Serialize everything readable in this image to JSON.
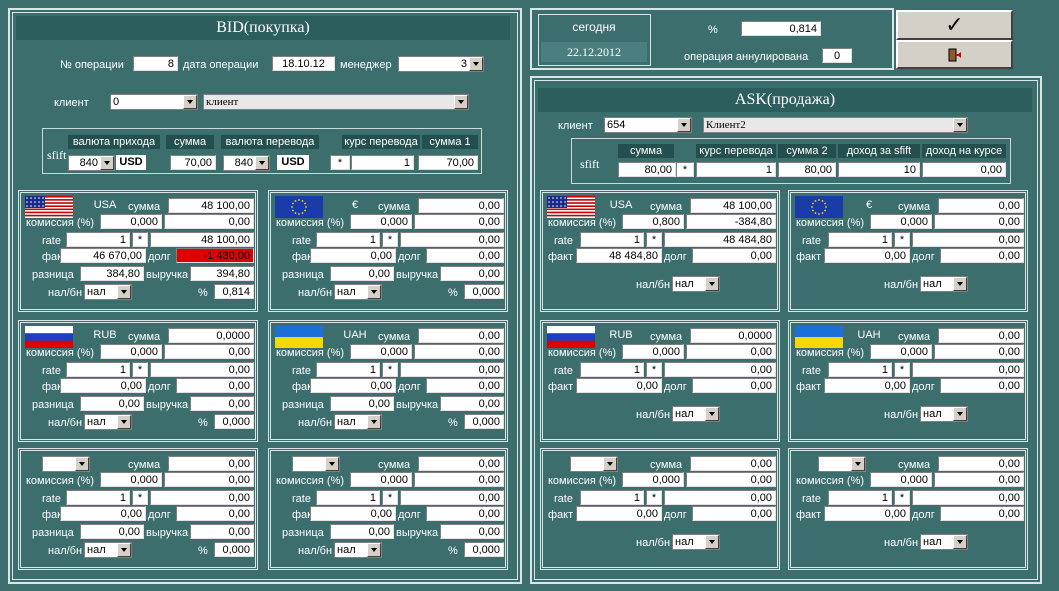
{
  "bid": {
    "title": "BID(покупка)",
    "op_no_label": "№ операции",
    "op_no": "8",
    "op_date_label": "дата операции",
    "op_date": "18.10.12",
    "manager_label": "менеджер",
    "manager": "3",
    "client_label": "клиент",
    "client_id": "0",
    "client_name": "клиент",
    "sfift": "sfift",
    "h_in": "валюта прихода",
    "h_sum": "сумма",
    "h_out": "валюта перевода",
    "h_rate": "курс перевода",
    "h_sum1": "сумма 1",
    "in_code": "840",
    "in_cur": "USD",
    "sum": "70,00",
    "out_code": "840",
    "out_cur": "USD",
    "rate": "1",
    "sum1": "70,00",
    "panels": [
      {
        "cur": "USA",
        "flag": "usa",
        "sum": "48 100,00",
        "kom": "0,000",
        "kom2": "0,00",
        "rate": "1",
        "rate2": "48 100,00",
        "fact": "46 670,00",
        "debt": "-1 430,00",
        "diff": "384,80",
        "rev": "394,80",
        "pay": "нал",
        "pct": "0,814"
      },
      {
        "cur": "€",
        "flag": "eu",
        "sum": "0,00",
        "kom": "0,000",
        "kom2": "0,00",
        "rate": "1",
        "rate2": "0,00",
        "fact": "0,00",
        "debt": "0,00",
        "diff": "0,00",
        "rev": "0,00",
        "pay": "нал",
        "pct": "0,000"
      },
      {
        "cur": "RUB",
        "flag": "rus",
        "sum": "0,0000",
        "kom": "0,000",
        "kom2": "0,00",
        "rate": "1",
        "rate2": "0,00",
        "fact": "0,00",
        "debt": "0,00",
        "diff": "0,00",
        "rev": "0,00",
        "pay": "нал",
        "pct": "0,000"
      },
      {
        "cur": "UAH",
        "flag": "ukr",
        "sum": "0,00",
        "kom": "0,000",
        "kom2": "0,00",
        "rate": "1",
        "rate2": "0,00",
        "fact": "0,00",
        "debt": "0,00",
        "diff": "0,00",
        "rev": "0,00",
        "pay": "нал",
        "pct": "0,000"
      },
      {
        "cur": "",
        "flag": "",
        "sum": "0,00",
        "kom": "0,000",
        "kom2": "0,00",
        "rate": "1",
        "rate2": "0,00",
        "fact": "0,00",
        "debt": "0,00",
        "diff": "0,00",
        "rev": "0,00",
        "pay": "нал",
        "pct": "0,000"
      },
      {
        "cur": "",
        "flag": "",
        "sum": "0,00",
        "kom": "0,000",
        "kom2": "0,00",
        "rate": "1",
        "rate2": "0,00",
        "fact": "0,00",
        "debt": "0,00",
        "diff": "0,00",
        "rev": "0,00",
        "pay": "нал",
        "pct": "0,000"
      }
    ]
  },
  "labels": {
    "sum": "сумма",
    "kom": "комиссия (%)",
    "rate": "rate",
    "fact": "факт",
    "debt": "долг",
    "diff": "разница",
    "rev": "выручка",
    "pay": "нал/бн",
    "pct": "%",
    "star": "*"
  },
  "top": {
    "today_label": "сегодня",
    "today": "22.12.2012",
    "pct_label": "%",
    "pct": "0,814",
    "cancel_label": "операция аннулирована",
    "cancel": "0"
  },
  "ask": {
    "title": "ASK(продажа)",
    "client_label": "клиент",
    "client_id": "654",
    "client_name": "Клиент2",
    "sfift": "sfift",
    "h_sum": "сумма",
    "h_rate": "курс перевода",
    "h_sum2": "сумма 2",
    "h_inc1": "доход за sfift",
    "h_inc2": "доход на курсе",
    "sum": "80,00",
    "rate": "1",
    "sum2": "80,00",
    "inc1": "10",
    "inc2": "0,00",
    "panels": [
      {
        "cur": "USA",
        "flag": "usa",
        "sum": "48 100,00",
        "kom": "0,800",
        "kom2": "-384,80",
        "rate": "1",
        "rate2": "48 484,80",
        "fact": "48 484,80",
        "debt": "0,00",
        "pay": "нал"
      },
      {
        "cur": "€",
        "flag": "eu",
        "sum": "0,00",
        "kom": "0,000",
        "kom2": "0,00",
        "rate": "1",
        "rate2": "0,00",
        "fact": "0,00",
        "debt": "0,00",
        "pay": "нал"
      },
      {
        "cur": "RUB",
        "flag": "rus",
        "sum": "0,0000",
        "kom": "0,000",
        "kom2": "0,00",
        "rate": "1",
        "rate2": "0,00",
        "fact": "0,00",
        "debt": "0,00",
        "pay": "нал"
      },
      {
        "cur": "UAH",
        "flag": "ukr",
        "sum": "0,00",
        "kom": "0,000",
        "kom2": "0,00",
        "rate": "1",
        "rate2": "0,00",
        "fact": "0,00",
        "debt": "0,00",
        "pay": "нал"
      },
      {
        "cur": "",
        "flag": "",
        "sum": "0,00",
        "kom": "0,000",
        "kom2": "0,00",
        "rate": "1",
        "rate2": "0,00",
        "fact": "0,00",
        "debt": "0,00",
        "pay": "нал"
      },
      {
        "cur": "",
        "flag": "",
        "sum": "0,00",
        "kom": "0,000",
        "kom2": "0,00",
        "rate": "1",
        "rate2": "0,00",
        "fact": "0,00",
        "debt": "0,00",
        "pay": "нал"
      }
    ]
  },
  "colors": {
    "bg": "#3c6e6e",
    "header": "#2d5e5e",
    "debt_negative": "#e00000"
  }
}
